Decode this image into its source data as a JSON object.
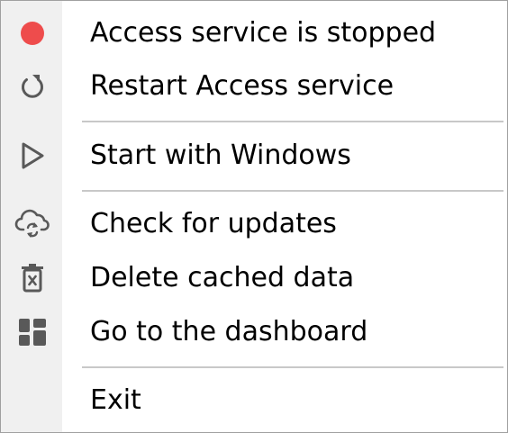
{
  "menu": {
    "items": [
      {
        "label": "Access service is stopped",
        "icon": "red-status-dot-icon"
      },
      {
        "label": "Restart Access service",
        "icon": "restart-icon"
      },
      {
        "label": "Start with Windows",
        "icon": "play-icon"
      },
      {
        "label": "Check for updates",
        "icon": "cloud-sync-icon"
      },
      {
        "label": "Delete cached data",
        "icon": "trash-icon"
      },
      {
        "label": "Go to the dashboard",
        "icon": "dashboard-icon"
      },
      {
        "label": "Exit",
        "icon": ""
      }
    ]
  },
  "colors": {
    "status_stopped": "#ee4c4c",
    "icon_gray": "#595959",
    "gutter": "#f0f0f0",
    "separator": "#c8c8c8"
  }
}
